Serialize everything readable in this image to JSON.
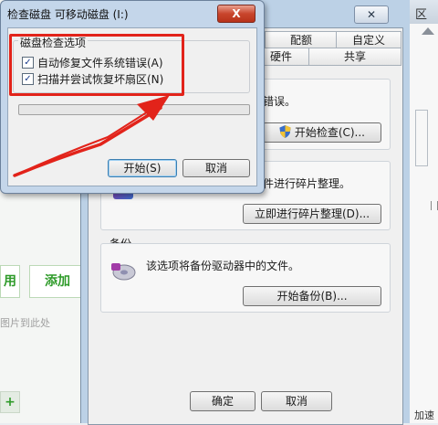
{
  "background_app": {
    "button_left_label": "用",
    "button_add_label": "添加",
    "drop_hint": "图片到此处",
    "plus": "+"
  },
  "right_strip": {
    "x_label": "区",
    "bottom_label": "加速"
  },
  "properties": {
    "tabs_row1": [
      "配额",
      "自定义"
    ],
    "tabs_row2": [
      "硬件",
      "共享"
    ],
    "errcheck_desc_fragment": "错误。",
    "errcheck_button": "开始检查(C)...",
    "defrag_desc_fragment": "件进行碎片整理。",
    "defrag_button": "立即进行碎片整理(D)...",
    "backup_title": "备份",
    "backup_desc": "该选项将备份驱动器中的文件。",
    "backup_button": "开始备份(B)...",
    "ok_button": "确定",
    "cancel_button": "取消"
  },
  "dialog": {
    "title": "检查磁盘 可移动磁盘 (I:)",
    "close_label": "X",
    "group_title": "磁盘检查选项",
    "options": [
      {
        "label": "自动修复文件系统错误(A)",
        "checked": true
      },
      {
        "label": "扫描并尝试恢复坏扇区(N)",
        "checked": true
      }
    ],
    "progress": 0,
    "start_button": "开始(S)",
    "cancel_button": "取消"
  },
  "colors": {
    "annotation": "#e2231a",
    "close_red": "#c9452c",
    "green": "#2f9b2a"
  }
}
